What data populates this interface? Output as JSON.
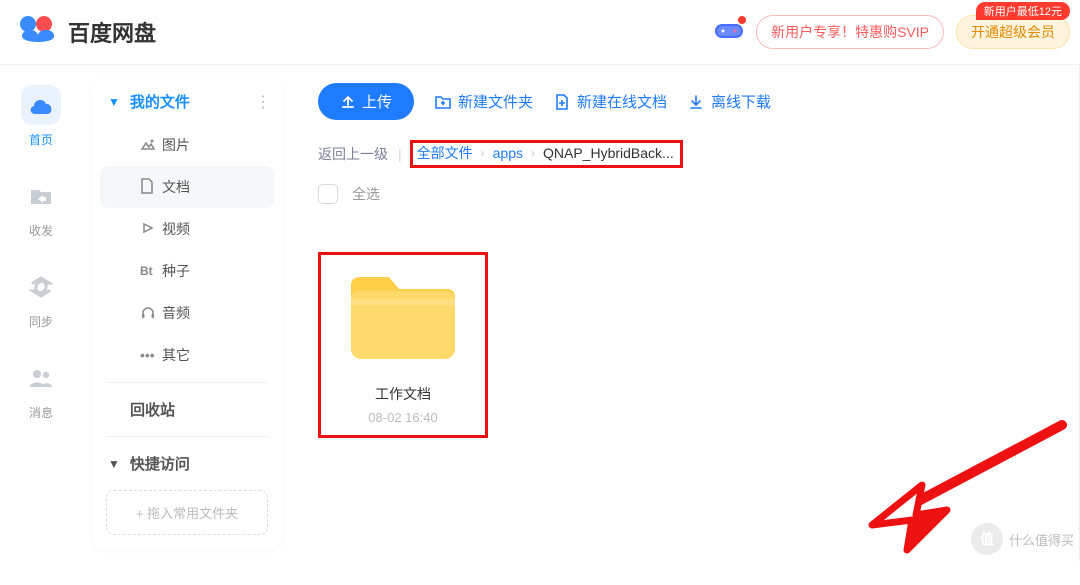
{
  "brand": "百度网盘",
  "header": {
    "promo1": "新用户专享！特惠购SVIP",
    "promo2": "开通超级会员",
    "promo2_badge": "新用户最低12元"
  },
  "nav_rail": {
    "items": [
      {
        "id": "home",
        "label": "首页"
      },
      {
        "id": "inbox",
        "label": "收发"
      },
      {
        "id": "sync",
        "label": "同步"
      },
      {
        "id": "msg",
        "label": "消息"
      }
    ]
  },
  "sidebar": {
    "my_files": "我的文件",
    "categories": [
      {
        "id": "pic",
        "label": "图片"
      },
      {
        "id": "doc",
        "label": "文档"
      },
      {
        "id": "vid",
        "label": "视频"
      },
      {
        "id": "bt",
        "label": "种子"
      },
      {
        "id": "aud",
        "label": "音频"
      },
      {
        "id": "other",
        "label": "其它"
      }
    ],
    "recycle": "回收站",
    "quick_access": "快捷访问",
    "drag_hint": "+ 拖入常用文件夹"
  },
  "toolbar": {
    "upload": "上传",
    "new_folder": "新建文件夹",
    "new_doc": "新建在线文档",
    "offline": "离线下载"
  },
  "breadcrumb": {
    "back": "返回上一级",
    "root": "全部文件",
    "seg1": "apps",
    "current": "QNAP_HybridBack..."
  },
  "select_all": "全选",
  "folder": {
    "name": "工作文档",
    "date": "08-02 16:40"
  },
  "watermark": "什么值得买"
}
